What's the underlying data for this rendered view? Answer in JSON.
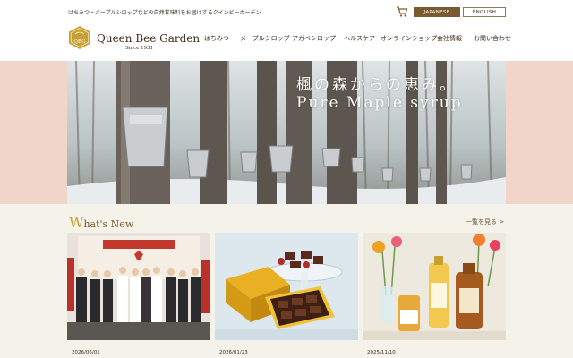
{
  "topbar": {
    "tagline": "はちみつ・メープルシロップなどの自然甘味料をお届けするクインビーガーデン",
    "cart_icon": "cart-icon",
    "lang_japanese": "JAPANESE",
    "lang_english": "ENGLISH"
  },
  "header": {
    "logo_mark": "QBG",
    "logo_name": "Queen Bee Garden",
    "logo_since": "Since 1931",
    "nav": [
      "はちみつ",
      "メープルシロップ",
      "アガベシロップ",
      "ヘルスケア",
      "オンラインショップ",
      "会社情報",
      "お問い合わせ"
    ]
  },
  "hero": {
    "title": "楓の森からの恵み。",
    "subtitle": "Pure Maple syrup"
  },
  "news": {
    "heading_initial": "W",
    "heading_rest": "hat's New",
    "more": "一覧を見る >",
    "items": [
      {
        "date": "2026/06/01"
      },
      {
        "date": "2026/01/23"
      },
      {
        "date": "2025/11/10"
      }
    ]
  },
  "colors": {
    "accent_brown": "#7a5a2e",
    "accent_gold": "#c8a030",
    "hero_band": "#f0d5c8",
    "page_bg": "#f5f2e9"
  }
}
